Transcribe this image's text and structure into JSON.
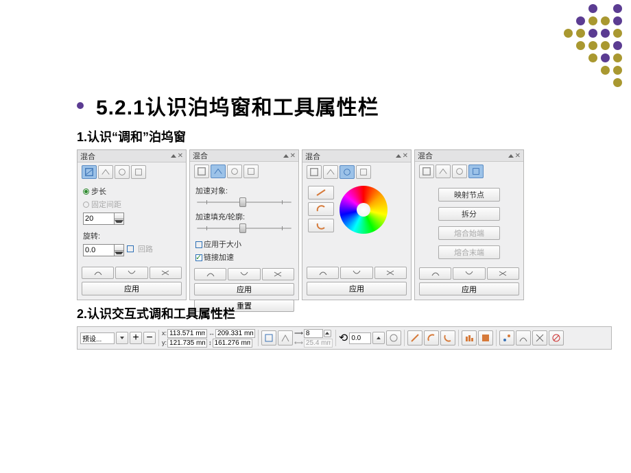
{
  "decor": {
    "dot_colors": [
      "",
      "",
      "",
      "",
      "#5b3c92",
      "",
      "#5b3c92",
      "",
      "",
      "",
      "#5b3c92",
      "#a99830",
      "#a99830",
      "#5b3c92",
      "",
      "",
      "#a99830",
      "#a99830",
      "#5b3c92",
      "#5b3c92",
      "#a99830",
      "",
      "",
      "",
      "#a99830",
      "#a99830",
      "#a99830",
      "#5b3c92",
      "",
      "",
      "",
      "",
      "#a99830",
      "#5b3c92",
      "#a99830",
      "",
      "",
      "",
      "",
      "",
      "#a99830",
      "#a99830",
      "",
      "",
      "",
      "",
      "",
      "",
      "#a99830"
    ]
  },
  "heading": "5.2.1认识泊坞窗和工具属性栏",
  "sub1": "1.认识“调和”泊坞窗",
  "sub2": "2.认识交互式调和工具属性栏",
  "common": {
    "docker_title": "混合",
    "apply": "应用",
    "reset": "重置"
  },
  "panel1": {
    "step_label": "步长",
    "fixed_label": "固定间距",
    "step_value": "20",
    "rotate_label": "旋转:",
    "rotate_value": "0.0",
    "loop_label": "回路"
  },
  "panel2": {
    "accel_obj": "加速对象:",
    "accel_fill": "加速填充/轮廓:",
    "apply_size": "应用于大小",
    "link_accel": "链接加速"
  },
  "panel4": {
    "map_nodes": "映射节点",
    "split": "拆分",
    "fuse_start": "熔合始端",
    "fuse_end": "熔合末端"
  },
  "propbar": {
    "preset_label": "预设...",
    "x_label": "x:",
    "y_label": "y:",
    "x_val": "113.571 mm",
    "y_val": "121.735 mm",
    "w_val": "209.331 mm",
    "h_val": "161.276 mm",
    "steps": "8",
    "disabled_val": "25.4 mm",
    "angle": "0.0"
  },
  "icons": {
    "tab_steps": "steps-icon",
    "tab_accel": "accel-icon",
    "tab_color": "color-icon",
    "tab_misc": "misc-icon"
  }
}
